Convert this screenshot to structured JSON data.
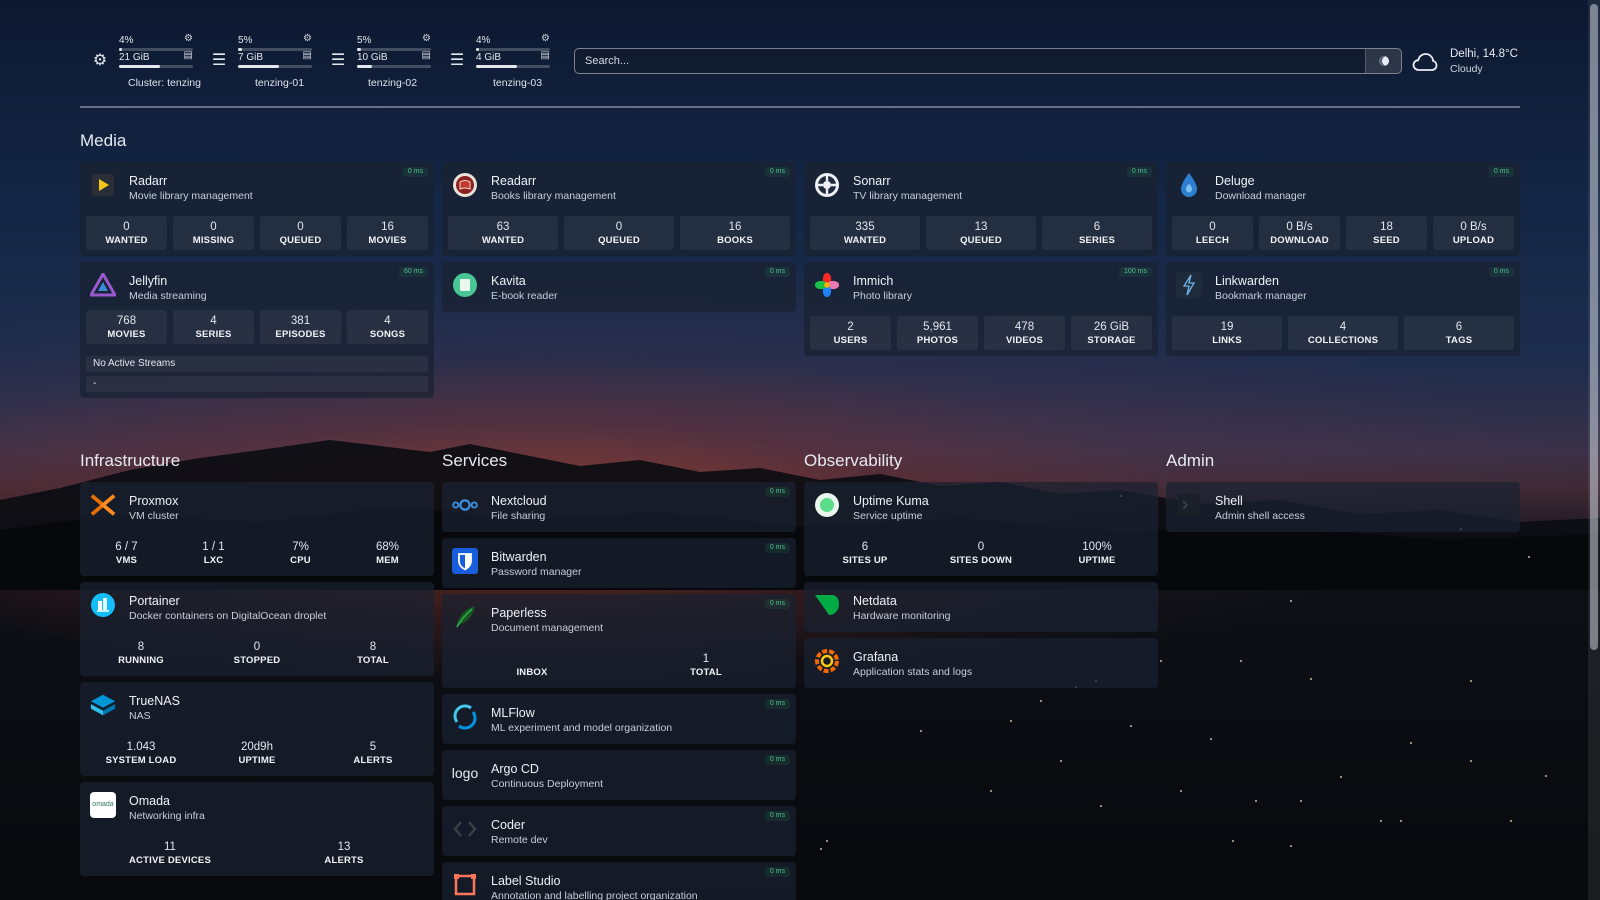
{
  "resources": [
    {
      "cpu": "4%",
      "mem": "21 GiB",
      "label": "Cluster: tenzing",
      "cpu_fraction": 0.04,
      "mem_fraction": 0.55,
      "icon": "cluster-icon"
    },
    {
      "cpu": "5%",
      "mem": "7 GiB",
      "label": "tenzing-01",
      "cpu_fraction": 0.05,
      "mem_fraction": 0.55,
      "icon": "server-icon"
    },
    {
      "cpu": "5%",
      "mem": "10 GiB",
      "label": "tenzing-02",
      "cpu_fraction": 0.05,
      "mem_fraction": 0.2,
      "icon": "server-icon"
    },
    {
      "cpu": "4%",
      "mem": "4 GiB",
      "label": "tenzing-03",
      "cpu_fraction": 0.04,
      "mem_fraction": 0.55,
      "icon": "server-icon"
    }
  ],
  "search": {
    "placeholder": "Search..."
  },
  "weather": {
    "location_temp": "Delhi, 14.8°C",
    "condition": "Cloudy"
  },
  "sections": {
    "media": "Media",
    "infrastructure": "Infrastructure",
    "services": "Services",
    "observability": "Observability",
    "admin": "Admin"
  },
  "media": {
    "radarr": {
      "name": "Radarr",
      "desc": "Movie library management",
      "ping": "0 ms",
      "stats": [
        {
          "n": "0",
          "l": "WANTED"
        },
        {
          "n": "0",
          "l": "MISSING"
        },
        {
          "n": "0",
          "l": "QUEUED"
        },
        {
          "n": "16",
          "l": "MOVIES"
        }
      ]
    },
    "readarr": {
      "name": "Readarr",
      "desc": "Books library management",
      "ping": "0 ms",
      "stats": [
        {
          "n": "63",
          "l": "WANTED"
        },
        {
          "n": "0",
          "l": "QUEUED"
        },
        {
          "n": "16",
          "l": "BOOKS"
        }
      ]
    },
    "sonarr": {
      "name": "Sonarr",
      "desc": "TV library management",
      "ping": "0 ms",
      "stats": [
        {
          "n": "335",
          "l": "WANTED"
        },
        {
          "n": "13",
          "l": "QUEUED"
        },
        {
          "n": "6",
          "l": "SERIES"
        }
      ]
    },
    "deluge": {
      "name": "Deluge",
      "desc": "Download manager",
      "ping": "0 ms",
      "stats": [
        {
          "n": "0",
          "l": "LEECH"
        },
        {
          "n": "0 B/s",
          "l": "DOWNLOAD"
        },
        {
          "n": "18",
          "l": "SEED"
        },
        {
          "n": "0 B/s",
          "l": "UPLOAD"
        }
      ]
    },
    "jellyfin": {
      "name": "Jellyfin",
      "desc": "Media streaming",
      "ping": "60 ms",
      "stats": [
        {
          "n": "768",
          "l": "MOVIES"
        },
        {
          "n": "4",
          "l": "SERIES"
        },
        {
          "n": "381",
          "l": "EPISODES"
        },
        {
          "n": "4",
          "l": "SONGS"
        }
      ],
      "streams": "No Active Streams",
      "streams_sub": "-"
    },
    "kavita": {
      "name": "Kavita",
      "desc": "E-book reader",
      "ping": "0 ms"
    },
    "immich": {
      "name": "Immich",
      "desc": "Photo library",
      "ping": "100 ms",
      "stats": [
        {
          "n": "2",
          "l": "USERS"
        },
        {
          "n": "5,961",
          "l": "PHOTOS"
        },
        {
          "n": "478",
          "l": "VIDEOS"
        },
        {
          "n": "26 GiB",
          "l": "STORAGE"
        }
      ]
    },
    "linkwarden": {
      "name": "Linkwarden",
      "desc": "Bookmark manager",
      "ping": "0 ms",
      "stats": [
        {
          "n": "19",
          "l": "LINKS"
        },
        {
          "n": "4",
          "l": "COLLECTIONS"
        },
        {
          "n": "6",
          "l": "TAGS"
        }
      ]
    }
  },
  "infrastructure": {
    "proxmox": {
      "name": "Proxmox",
      "desc": "VM cluster",
      "stats": [
        {
          "n": "6 / 7",
          "l": "VMS"
        },
        {
          "n": "1 / 1",
          "l": "LXC"
        },
        {
          "n": "7%",
          "l": "CPU"
        },
        {
          "n": "68%",
          "l": "MEM"
        }
      ]
    },
    "portainer": {
      "name": "Portainer",
      "desc": "Docker containers on DigitalOcean droplet",
      "stats": [
        {
          "n": "8",
          "l": "RUNNING"
        },
        {
          "n": "0",
          "l": "STOPPED"
        },
        {
          "n": "8",
          "l": "TOTAL"
        }
      ]
    },
    "truenas": {
      "name": "TrueNAS",
      "desc": "NAS",
      "stats": [
        {
          "n": "1.043",
          "l": "SYSTEM LOAD"
        },
        {
          "n": "20d9h",
          "l": "UPTIME"
        },
        {
          "n": "5",
          "l": "ALERTS"
        }
      ]
    },
    "omada": {
      "name": "Omada",
      "desc": "Networking infra",
      "logo_text": "omada",
      "stats": [
        {
          "n": "11",
          "l": "ACTIVE DEVICES"
        },
        {
          "n": "13",
          "l": "ALERTS"
        }
      ]
    }
  },
  "services": {
    "nextcloud": {
      "name": "Nextcloud",
      "desc": "File sharing",
      "ping": "0 ms"
    },
    "bitwarden": {
      "name": "Bitwarden",
      "desc": "Password manager",
      "ping": "0 ms"
    },
    "paperless": {
      "name": "Paperless",
      "desc": "Document management",
      "ping": "0 ms",
      "stats": [
        {
          "n": "",
          "l": "INBOX"
        },
        {
          "n": "1",
          "l": "TOTAL"
        }
      ]
    },
    "mlflow": {
      "name": "MLFlow",
      "desc": "ML experiment and model organization",
      "ping": "0 ms"
    },
    "argocd": {
      "name": "Argo CD",
      "desc": "Continuous Deployment",
      "ping": "0 ms",
      "logo_text": "logo"
    },
    "coder": {
      "name": "Coder",
      "desc": "Remote dev",
      "ping": "0 ms"
    },
    "labelstudio": {
      "name": "Label Studio",
      "desc": "Annotation and labelling project organization",
      "ping": "0 ms"
    }
  },
  "observability": {
    "uptimekuma": {
      "name": "Uptime Kuma",
      "desc": "Service uptime",
      "stats": [
        {
          "n": "6",
          "l": "SITES UP"
        },
        {
          "n": "0",
          "l": "SITES DOWN"
        },
        {
          "n": "100%",
          "l": "UPTIME"
        }
      ]
    },
    "netdata": {
      "name": "Netdata",
      "desc": "Hardware monitoring"
    },
    "grafana": {
      "name": "Grafana",
      "desc": "Application stats and logs"
    }
  },
  "admin": {
    "shell": {
      "name": "Shell",
      "desc": "Admin shell access"
    }
  }
}
